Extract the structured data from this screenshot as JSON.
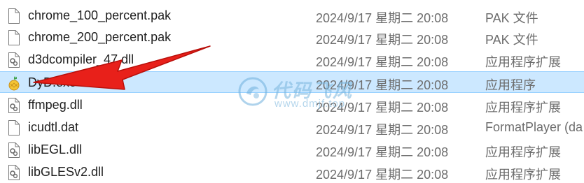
{
  "files": [
    {
      "name": "chrome_100_percent.pak",
      "modified": "2024/9/17 星期二 20:08",
      "type": "PAK 文件",
      "icon": "file-icon"
    },
    {
      "name": "chrome_200_percent.pak",
      "modified": "2024/9/17 星期二 20:08",
      "type": "PAK 文件",
      "icon": "file-icon"
    },
    {
      "name": "d3dcompiler_47.dll",
      "modified": "2024/9/17 星期二 20:08",
      "type": "应用程序扩展",
      "icon": "dll-icon"
    },
    {
      "name": "DyD.exe",
      "modified": "2024/9/17 星期二 20:08",
      "type": "应用程序",
      "icon": "app-icon",
      "selected": true
    },
    {
      "name": "ffmpeg.dll",
      "modified": "2024/9/17 星期二 20:08",
      "type": "应用程序扩展",
      "icon": "dll-icon"
    },
    {
      "name": "icudtl.dat",
      "modified": "2024/9/17 星期二 20:08",
      "type": "FormatPlayer (da",
      "icon": "file-icon"
    },
    {
      "name": "libEGL.dll",
      "modified": "2024/9/17 星期二 20:08",
      "type": "应用程序扩展",
      "icon": "dll-icon"
    },
    {
      "name": "libGLESv2.dll",
      "modified": "2024/9/17 星期二 20:08",
      "type": "应用程序扩展",
      "icon": "dll-icon"
    }
  ],
  "watermark": {
    "title": "代码飞风",
    "url": "www.dmjf.top"
  },
  "colors": {
    "selection": "#cce8ff",
    "selection_border": "#99d1ff",
    "arrow": "#e8201a"
  }
}
